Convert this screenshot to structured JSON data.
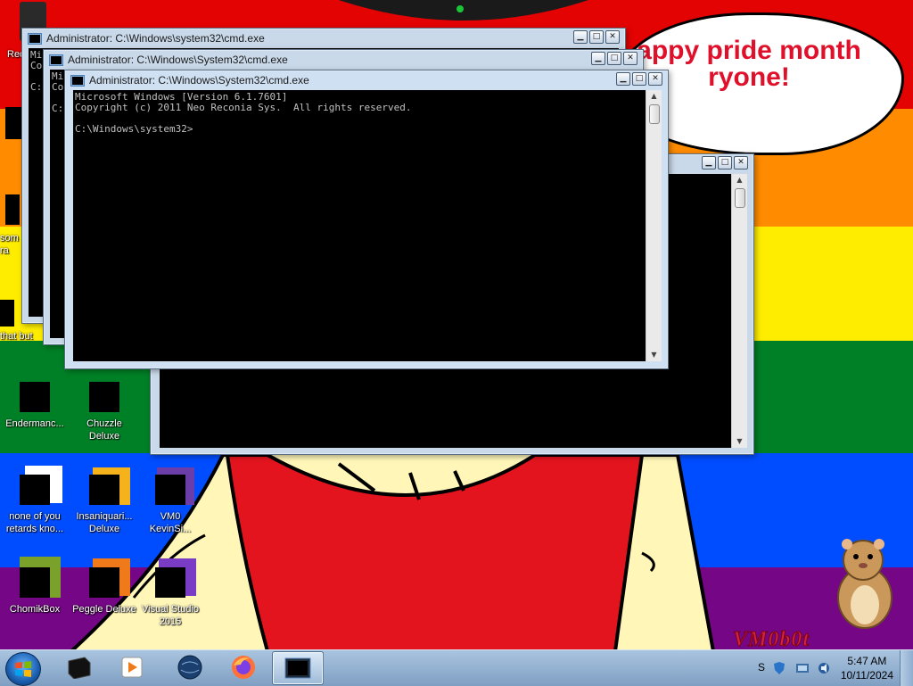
{
  "wallpaper": {
    "stripes": [
      "#e40303",
      "#ff8c00",
      "#ffed00",
      "#008026",
      "#004dff",
      "#750787"
    ],
    "speech_bubble_text": "Happy pride month\neveryone!",
    "visible_bubble_line1": "appy pride month",
    "visible_bubble_line2": "ryone!",
    "watermark": "VM0b0t",
    "accent_red": "#e0102b"
  },
  "windows": [
    {
      "title": "Administrator: C:\\Windows\\system32\\cmd.exe",
      "console_lines": [
        "Mi",
        "Co",
        "",
        "C:"
      ]
    },
    {
      "title": "Administrator: C:\\Windows\\System32\\cmd.exe",
      "console_lines": [
        "Mi",
        "Co",
        "",
        "C:"
      ]
    },
    {
      "title": "Administrator: C:\\Windows\\System32\\cmd.exe",
      "console_lines": [
        "Microsoft Windows [Version 6.1.7601]",
        "Copyright (c) 2011 Neo Reconia Sys.  All rights reserved.",
        "",
        "C:\\Windows\\system32>"
      ]
    },
    {
      "title": "",
      "console_lines": []
    }
  ],
  "window_controls": {
    "minimize": "▁",
    "maximize": "□",
    "close": "✕"
  },
  "desktop_icons": [
    {
      "label": "Rec",
      "icon": "recycle-bin-icon"
    },
    {
      "label": "",
      "icon": "unknown-icon"
    },
    {
      "label": "som\nra",
      "icon": "unknown-icon"
    },
    {
      "label": "that but",
      "icon": "unknown-icon"
    },
    {
      "label": "Endermanc...",
      "icon": "program-icon"
    },
    {
      "label": "Chuzzle\nDeluxe",
      "icon": "game-icon"
    },
    {
      "label": "none of you\nretards kno...",
      "icon": "file-icon"
    },
    {
      "label": "Insaniquari...\nDeluxe",
      "icon": "game-icon"
    },
    {
      "label": "VM0\nKevinSi...",
      "icon": "program-icon"
    },
    {
      "label": "ChomikBox",
      "icon": "program-icon"
    },
    {
      "label": "Peggle Deluxe",
      "icon": "game-icon"
    },
    {
      "label": "Visual Studio\n2015",
      "icon": "visual-studio-icon"
    }
  ],
  "taskbar": {
    "pinned": [
      {
        "name": "program-icon"
      },
      {
        "name": "media-player-icon"
      },
      {
        "name": "globe-icon"
      },
      {
        "name": "firefox-icon"
      },
      {
        "name": "cmd-icon",
        "active": true
      }
    ],
    "tray_label": "S",
    "time": "5:47 AM",
    "date": "10/11/2024"
  }
}
